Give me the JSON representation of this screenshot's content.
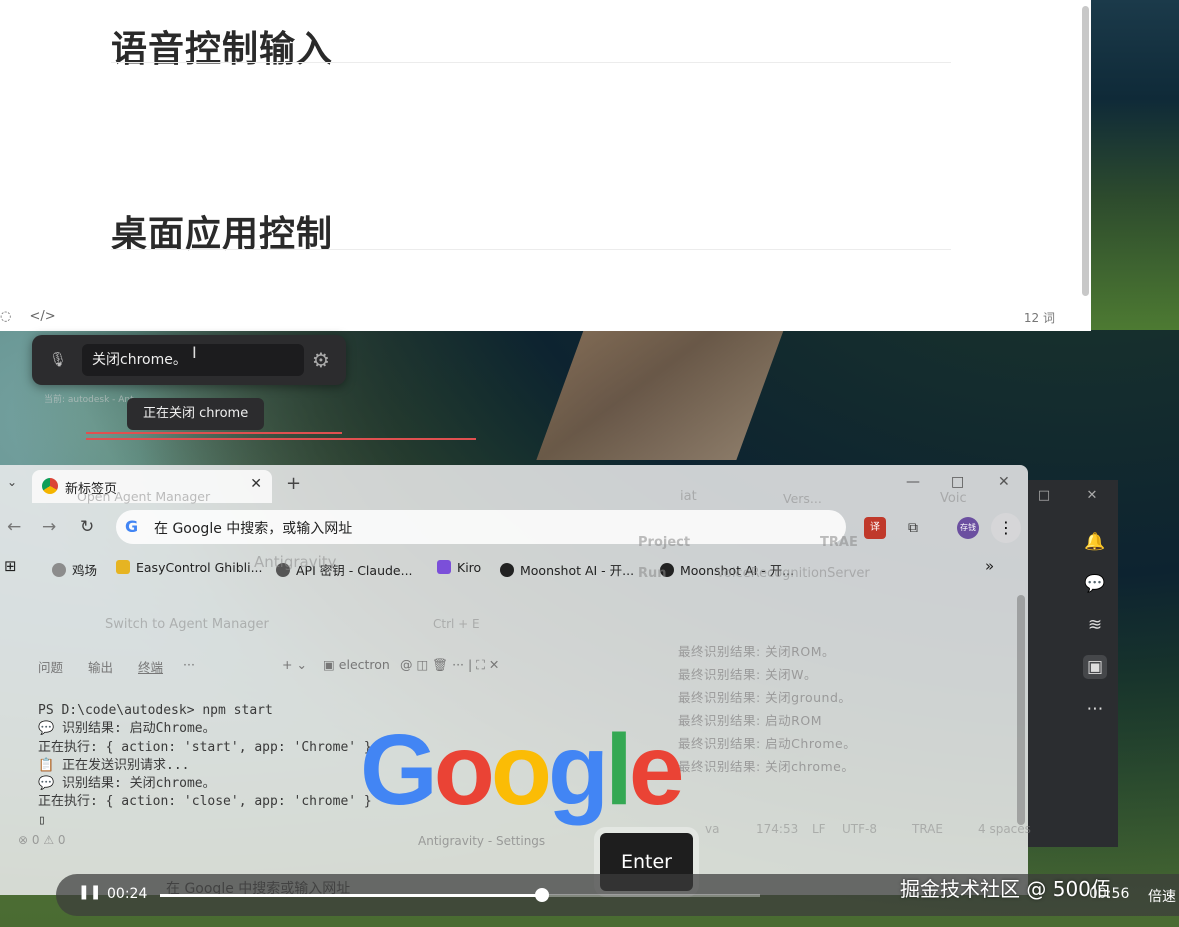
{
  "editor": {
    "heading_1": "语音控制输入",
    "heading_2": "桌面应用控制",
    "word_count": "12 词",
    "source_mode_icon": "</>"
  },
  "voice_input": {
    "value": "关闭chrome。",
    "status_tooltip": "正在关闭 chrome",
    "faint_label": "当前: autodesk - Ant"
  },
  "chrome": {
    "tab_title": "新标签页",
    "new_tab": "+",
    "omnibox_placeholder": "在 Google 中搜索，或输入网址",
    "bookmarks": [
      {
        "label": "鸡场",
        "color": "#8c8c8c"
      },
      {
        "label": "EasyControl Ghibli...",
        "color": "#e6b422"
      },
      {
        "label": "API 密钥 - Claude...",
        "color": "#555555"
      },
      {
        "label": "Kiro",
        "color": "#7b4fd9"
      },
      {
        "label": "Moonshot AI - 开...",
        "color": "#222222"
      },
      {
        "label": "Moonshot AI - 开...",
        "color": "#222222"
      }
    ],
    "more_bookmarks": "»",
    "profile_label": "存钱",
    "logo": [
      "G",
      "o",
      "o",
      "g",
      "l",
      "e"
    ],
    "logo_colors": [
      "#4285f4",
      "#ea4335",
      "#fbbc05",
      "#4285f4",
      "#34a853",
      "#ea4335"
    ]
  },
  "ghost_ide": {
    "open_agent_manager": "Open Agent Manager",
    "antigravity": "Antigravity",
    "switch_agent": "Switch to Agent Manager",
    "shortcut": "Ctrl + E",
    "panel_tabs": [
      "问题",
      "输出",
      "终端",
      "···"
    ],
    "terminal_name": "electron",
    "project": "Project",
    "trae": "TRAE",
    "run": "Run",
    "run_target": "VoiceRecognitionServer",
    "versions": "Vers...",
    "voice_tab": "Voic",
    "iat_tab": "iat",
    "status_errors": "⊗ 0 ⚠ 0",
    "status_center": "Antigravity - Settings",
    "status_java": "va",
    "status_position": "174:53",
    "status_lf": "LF",
    "status_encoding": "UTF-8",
    "status_trae": "TRAE",
    "status_indent": "4 spaces"
  },
  "terminal": {
    "lines": [
      "PS D:\\code\\autodesk> npm start",
      "💬 识别结果: 启动Chrome。",
      "正在执行: { action: 'start', app: 'Chrome' }",
      "📋 正在发送识别请求...",
      "💬 识别结果: 关闭chrome。",
      "正在执行: { action: 'close', app: 'chrome' }",
      "▯"
    ]
  },
  "run_console": {
    "lines": [
      "最终识别结果: 关闭ROM。",
      "最终识别结果: 关闭W。",
      "最终识别结果: 关闭ground。",
      "最终识别结果: 启动ROM",
      "最终识别结果: 启动Chrome。",
      "最终识别结果: 关闭chrome。"
    ]
  },
  "key_overlay": "Enter",
  "player": {
    "current_time": "00:24",
    "duration": "00:56",
    "speed": "倍速",
    "progress": 0.636,
    "underlay_text": "在 Google 中搜索或输入网址"
  },
  "watermark": "掘金技术社区 @ 500佰"
}
